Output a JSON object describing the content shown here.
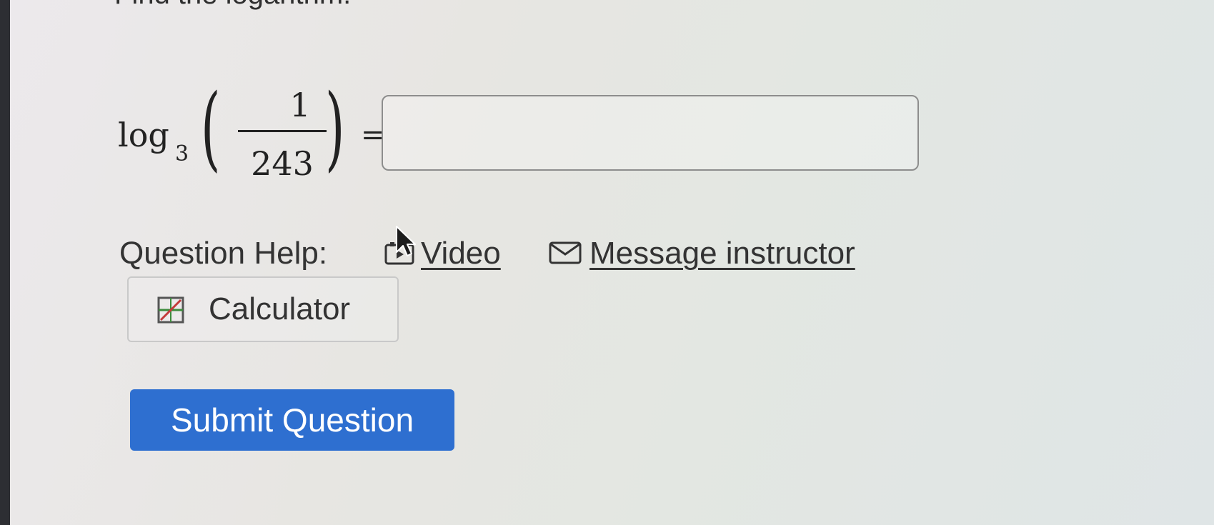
{
  "question": {
    "instruction": "Find the logarithm.",
    "expression": {
      "function": "log",
      "base": "3",
      "numerator": "1",
      "denominator": "243",
      "equals": "="
    },
    "answer_value": ""
  },
  "help": {
    "label": "Question Help:",
    "video_label": "Video",
    "message_label": "Message instructor",
    "calculator_label": "Calculator"
  },
  "actions": {
    "submit_label": "Submit Question"
  },
  "colors": {
    "submit_bg": "#2e6fd0",
    "input_border": "#8d8d8d"
  },
  "icons": {
    "video": "video-icon",
    "message": "envelope-icon",
    "calculator": "calculator-icon",
    "cursor": "mouse-pointer-icon"
  }
}
